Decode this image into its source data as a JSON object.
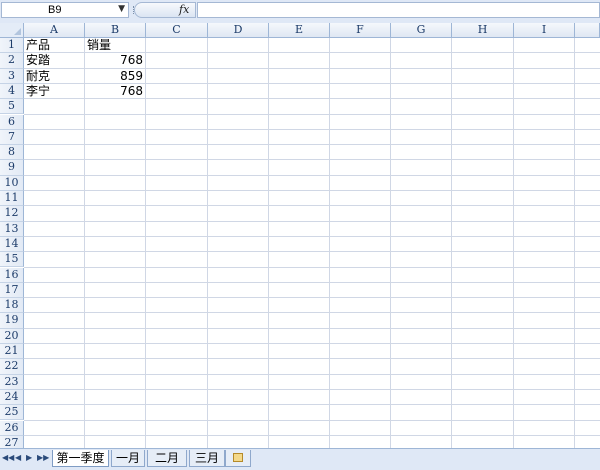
{
  "formula_bar": {
    "name_box": "B9",
    "fx_label": "fx",
    "formula": ""
  },
  "columns": [
    "A",
    "B",
    "C",
    "D",
    "E",
    "F",
    "G",
    "H",
    "I"
  ],
  "rows": [
    "1",
    "2",
    "3",
    "4",
    "5",
    "6",
    "7",
    "8",
    "9",
    "10",
    "11",
    "12",
    "13",
    "14",
    "15",
    "16",
    "17",
    "18",
    "19",
    "20",
    "21",
    "22",
    "23",
    "24",
    "25",
    "26",
    "27"
  ],
  "cells": {
    "A1": "产品",
    "B1": "销量",
    "A2": "安踏",
    "B2": "768",
    "A3": "耐克",
    "B3": "859",
    "A4": "李宁",
    "B4": "768"
  },
  "sheet_tabs": {
    "nav": [
      "◀◀",
      "◀",
      "▶",
      "▶▶"
    ],
    "tabs": [
      "第一季度",
      "一月",
      "二月",
      "三月"
    ],
    "active": "第一季度"
  }
}
